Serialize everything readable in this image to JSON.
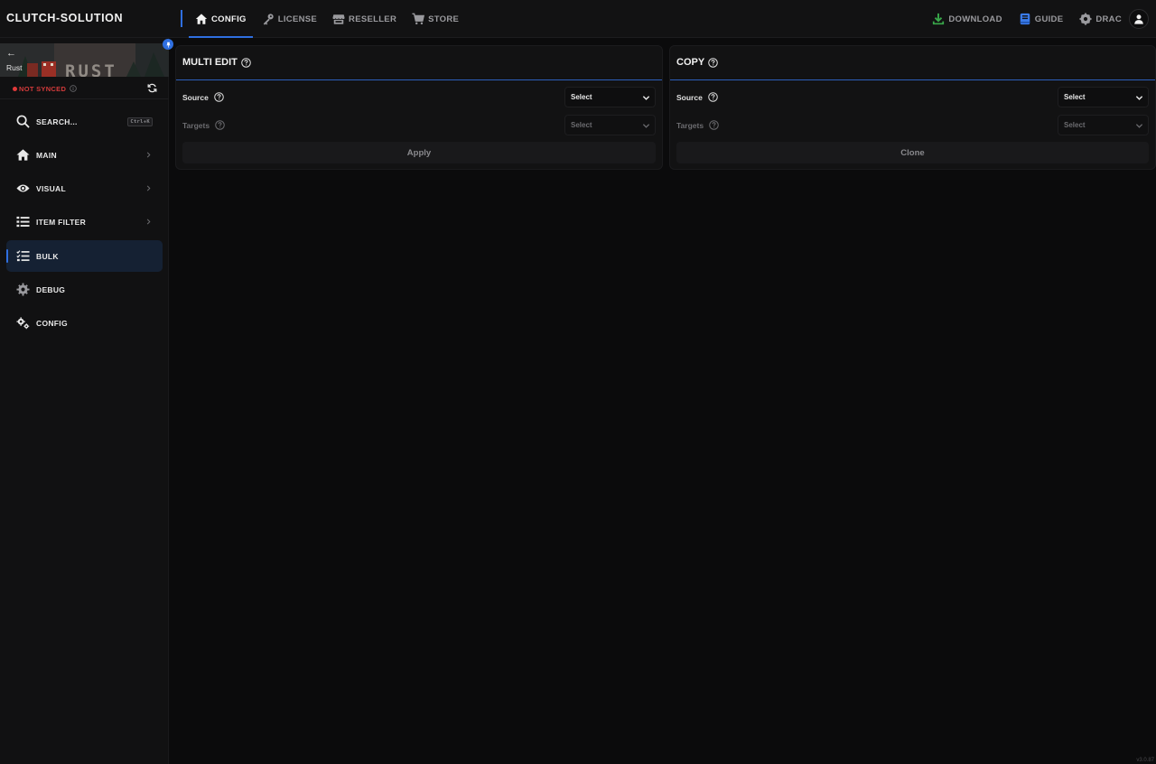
{
  "app": {
    "brand": "CLUTCH-SOLUTION",
    "version": "v3.0.87",
    "accent_color": "#2f6fe0"
  },
  "top_nav": {
    "items": [
      {
        "label": "CONFIG",
        "icon": "home-icon",
        "active": true
      },
      {
        "label": "LICENSE",
        "icon": "key-icon",
        "active": false
      },
      {
        "label": "RESELLER",
        "icon": "store-icon",
        "active": false
      },
      {
        "label": "STORE",
        "icon": "cart-icon",
        "active": false
      }
    ],
    "right": {
      "download": "DOWNLOAD",
      "guide": "GUIDE",
      "user": "DRAC"
    }
  },
  "sidebar": {
    "game": {
      "back": "←",
      "name": "Rust",
      "banner_text": "RUST"
    },
    "sync_status": "NOT SYNCED",
    "search": {
      "label": "SEARCH...",
      "shortcut": "Ctrl+K"
    },
    "items": [
      {
        "label": "MAIN",
        "icon": "home-icon",
        "has_chevron": true
      },
      {
        "label": "VISUAL",
        "icon": "eye-icon",
        "has_chevron": true
      },
      {
        "label": "ITEM FILTER",
        "icon": "list-icon",
        "has_chevron": true
      },
      {
        "label": "BULK",
        "icon": "checklist-icon",
        "active": true
      },
      {
        "label": "DEBUG",
        "icon": "gear-icon"
      },
      {
        "label": "CONFIG",
        "icon": "gears-icon"
      }
    ]
  },
  "panels": {
    "multi_edit": {
      "title": "MULTI EDIT",
      "source_label": "Source",
      "source_value": "Select",
      "targets_label": "Targets",
      "targets_value": "Select",
      "button": "Apply"
    },
    "copy": {
      "title": "COPY",
      "source_label": "Source",
      "source_value": "Select",
      "targets_label": "Targets",
      "targets_value": "Select",
      "button": "Clone"
    }
  }
}
